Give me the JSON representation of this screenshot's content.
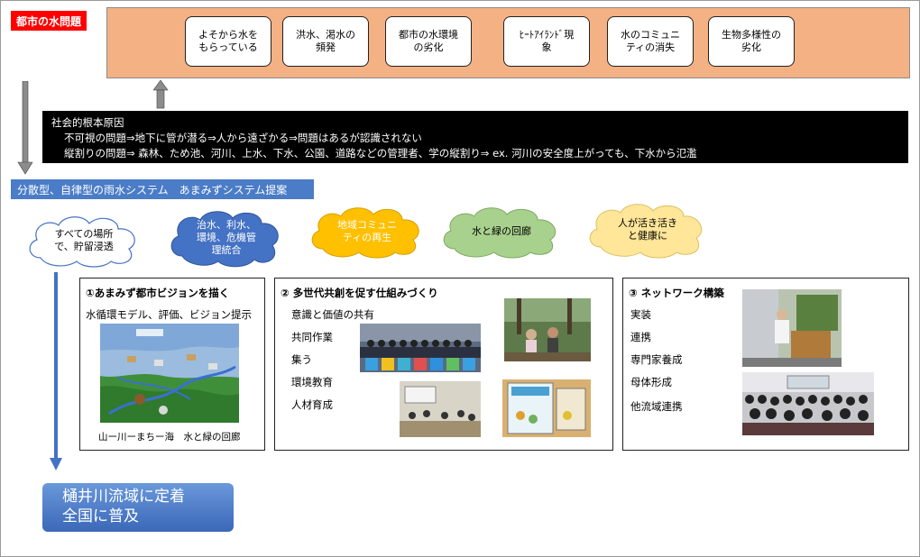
{
  "header": {
    "label": "都市の水問題"
  },
  "problems": [
    {
      "line1": "よそから水を",
      "line2": "もらっている"
    },
    {
      "line1": "洪水、渇水の",
      "line2": "頻発"
    },
    {
      "line1": "都市の水環境",
      "line2": "の劣化"
    },
    {
      "line1": "ﾋｰﾄｱｲﾗﾝﾄﾞ現",
      "line2": "象"
    },
    {
      "line1": "水のコミュニ",
      "line2": "ティの消失"
    },
    {
      "line1": "生物多様性の",
      "line2": "劣化"
    }
  ],
  "root_cause": {
    "title": "社会的根本原因",
    "line1": "不可視の問題⇒地下に管が潜る⇒人から遠ざかる⇒問題はあるが認識されない",
    "line2": "縦割りの問題⇒ 森林、ため池、河川、上水、下水、公園、道路などの管理者、学の縦割り⇒ ex. 河川の安全度上がっても、下水から氾濫"
  },
  "proposal": {
    "label": "分散型、自律型の雨水システム　あまみずシステム提案"
  },
  "clouds": [
    {
      "line1": "すべての場所",
      "line2": "で、貯留浸透",
      "line3": "",
      "color": "#ffffff",
      "text_color": "#000000"
    },
    {
      "line1": "治水、利水、",
      "line2": "環境、危機管",
      "line3": "理統合",
      "color": "#4472c4",
      "text_color": "#ffffff"
    },
    {
      "line1": "地域コミュニ",
      "line2": "ティの再生",
      "line3": "",
      "color": "#ffc000",
      "text_color": "#ffffff"
    },
    {
      "line1": "水と緑の回廊",
      "line2": "",
      "line3": "",
      "color": "#a9d18e",
      "text_color": "#000000"
    },
    {
      "line1": "人が活き活き",
      "line2": "と健康に",
      "line3": "",
      "color": "#ffe699",
      "text_color": "#000000"
    }
  ],
  "panel1": {
    "title": "①あまみず都市ビジョンを描く",
    "subtitle": "水循環モデル、評価、ビジョン提示",
    "caption": "山ー川ーまちー海　水と緑の回廊"
  },
  "panel2": {
    "title": "② 多世代共創を促す仕組みづくり",
    "items": [
      "意識と価値の共有",
      "共同作業",
      "集う",
      "環境教育",
      "人材育成"
    ]
  },
  "panel3": {
    "title": "③ ネットワーク構築",
    "items": [
      "実装",
      "連携",
      "専門家養成",
      "母体形成",
      "他流域連携"
    ]
  },
  "final": {
    "line1": "樋井川流域に定着",
    "line2": "全国に普及"
  },
  "colors": {
    "red": "#ff0000",
    "salmon": "#f4b183",
    "blue": "#4a7cc7",
    "arrow_gray": "#7f7f7f",
    "arrow_blue": "#4472c4"
  }
}
